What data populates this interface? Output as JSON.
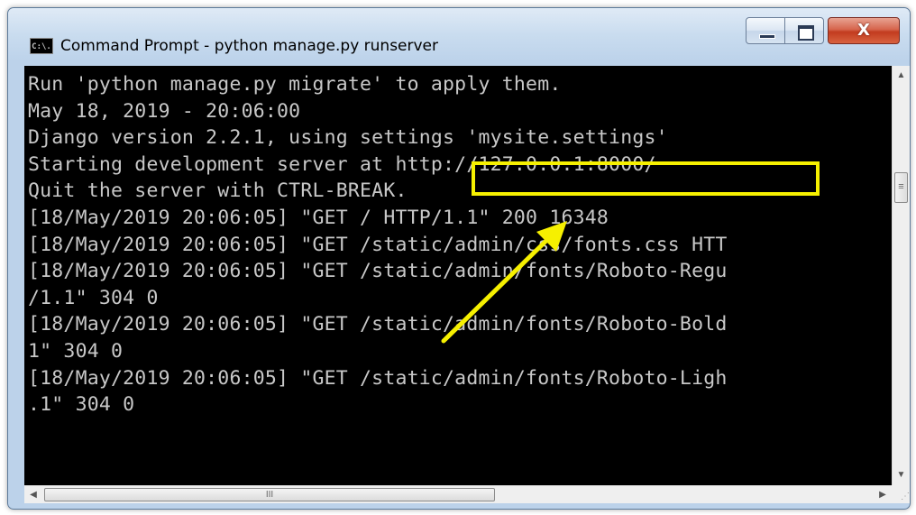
{
  "window": {
    "title": "Command Prompt - python  manage.py  runserver",
    "icon_label": "C:\\.",
    "controls": {
      "minimize": "minimize",
      "maximize": "maximize",
      "close_label": "X"
    }
  },
  "console": {
    "lines": [
      "Run 'python manage.py migrate' to apply them.",
      "May 18, 2019 - 20:06:00",
      "Django version 2.2.1, using settings 'mysite.settings'",
      "Starting development server at http://127.0.0.1:8000/",
      "Quit the server with CTRL-BREAK.",
      "[18/May/2019 20:06:05] \"GET / HTTP/1.1\" 200 16348",
      "[18/May/2019 20:06:05] \"GET /static/admin/css/fonts.css HTT",
      "[18/May/2019 20:06:05] \"GET /static/admin/fonts/Roboto-Regu",
      "/1.1\" 304 0",
      "[18/May/2019 20:06:05] \"GET /static/admin/fonts/Roboto-Bold",
      "1\" 304 0",
      "[18/May/2019 20:06:05] \"GET /static/admin/fonts/Roboto-Ligh",
      ".1\" 304 0"
    ],
    "text_color": "#c8c8c8",
    "background": "#000000"
  },
  "annotation": {
    "highlight_color": "#f6f000",
    "highlight_icon": "arrow-pointer-icon"
  },
  "scrollbars": {
    "up_icon": "▲",
    "down_icon": "▼",
    "left_icon": "◀",
    "right_icon": "▶",
    "v_grip": "≡",
    "h_grip": "III"
  }
}
